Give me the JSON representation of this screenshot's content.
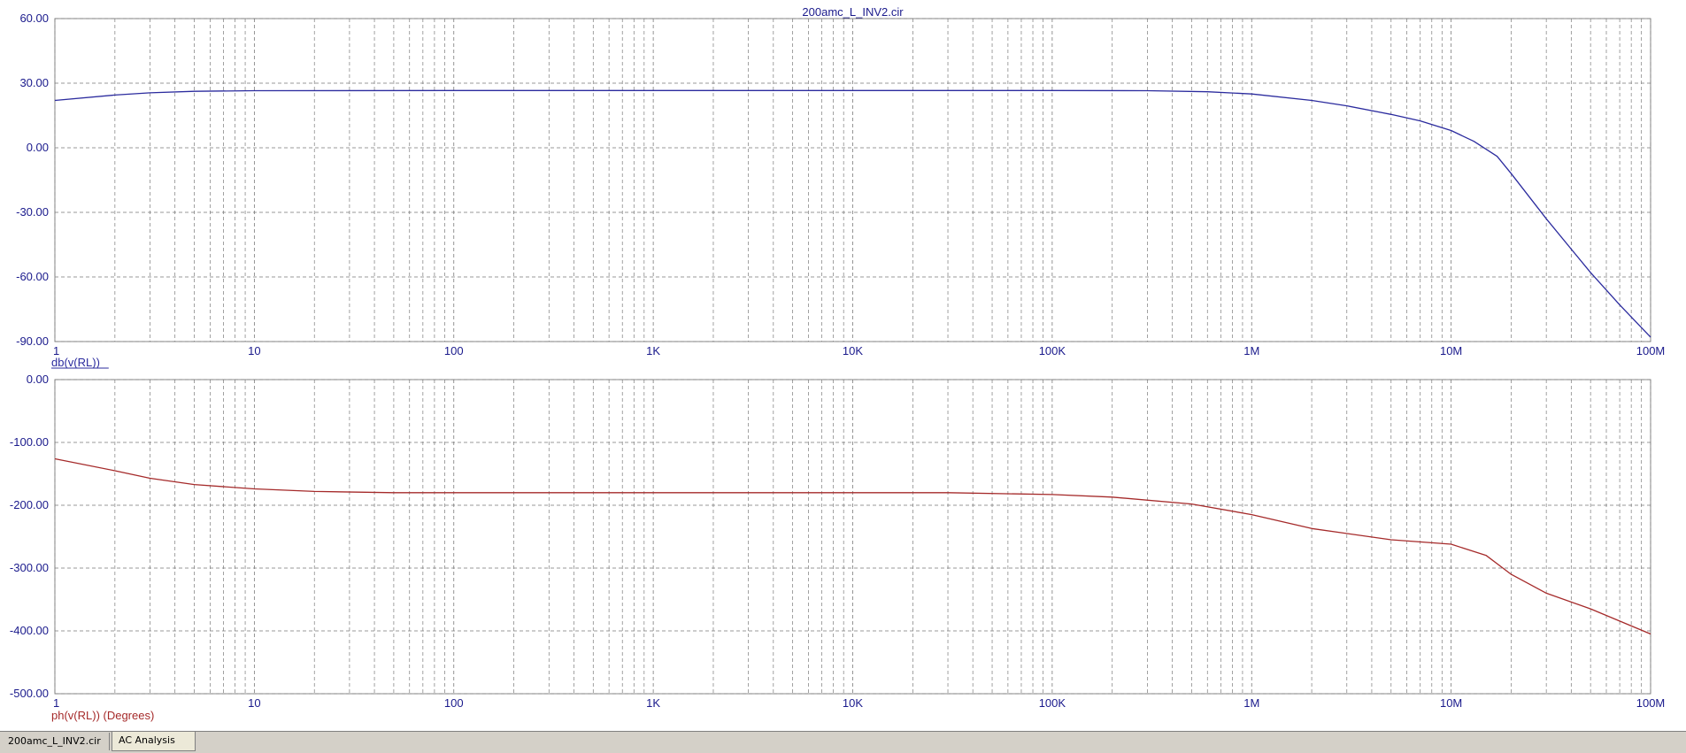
{
  "window_title": "200amc_L_INV2.cir",
  "tabs": [
    {
      "label": "200amc_L_INV2.cir",
      "active": false
    },
    {
      "label": "AC Analysis",
      "active": true
    }
  ],
  "colors": {
    "magnitude": "#2b2b9e",
    "phase": "#a52a2a",
    "axis_text": "#1a1a8c",
    "grid": "#7a7a7a",
    "frame": "#888888"
  },
  "chart_data": [
    {
      "type": "line",
      "title": "200amc_L_INV2.cir",
      "xscale": "log",
      "xlim": [
        1,
        100000000
      ],
      "xticks": [
        1,
        10,
        100,
        1000,
        10000,
        100000,
        1000000,
        10000000,
        100000000
      ],
      "xtick_labels": [
        "1",
        "10",
        "100",
        "1K",
        "10K",
        "100K",
        "1M",
        "10M",
        "100M"
      ],
      "ylim": [
        -90,
        60
      ],
      "yticks": [
        60,
        30,
        0,
        -30,
        -60,
        -90
      ],
      "ytick_labels": [
        "60.00",
        "30.00",
        "0.00",
        "-30.00",
        "-60.00",
        "-90.00"
      ],
      "grid": true,
      "series": [
        {
          "name": "db(v(RL))",
          "color": "#2b2b9e",
          "x": [
            1,
            2,
            3,
            5,
            10,
            100,
            1000,
            10000,
            100000,
            300000,
            600000,
            1000000,
            2000000,
            3000000,
            5000000,
            7000000,
            10000000,
            13000000,
            17000000,
            20000000,
            30000000,
            50000000,
            70000000,
            100000000
          ],
          "y": [
            22,
            24.5,
            25.5,
            26.2,
            26.5,
            26.6,
            26.6,
            26.6,
            26.6,
            26.5,
            26,
            25,
            22,
            19.5,
            15.5,
            12.5,
            8,
            3,
            -4,
            -12,
            -33,
            -58,
            -73,
            -88
          ]
        }
      ]
    },
    {
      "type": "line",
      "xscale": "log",
      "xlim": [
        1,
        100000000
      ],
      "xticks": [
        1,
        10,
        100,
        1000,
        10000,
        100000,
        1000000,
        10000000,
        100000000
      ],
      "xtick_labels": [
        "1",
        "10",
        "100",
        "1K",
        "10K",
        "100K",
        "1M",
        "10M",
        "100M"
      ],
      "ylim": [
        -500,
        0
      ],
      "yticks": [
        0,
        -100,
        -200,
        -300,
        -400,
        -500
      ],
      "ytick_labels": [
        "0.00",
        "-100.00",
        "-200.00",
        "-300.00",
        "-400.00",
        "-500.00"
      ],
      "grid": true,
      "series": [
        {
          "name": "ph(v(RL)) (Degrees)",
          "color": "#a52a2a",
          "x": [
            1,
            2,
            3,
            5,
            10,
            20,
            50,
            100,
            1000,
            10000,
            30000,
            100000,
            200000,
            500000,
            1000000,
            2000000,
            5000000,
            10000000,
            15000000,
            20000000,
            30000000,
            50000000,
            100000000
          ],
          "y": [
            -126,
            -145,
            -157,
            -167,
            -174,
            -178,
            -180,
            -180,
            -180,
            -180,
            -180,
            -183,
            -187,
            -198,
            -215,
            -237,
            -255,
            -262,
            -280,
            -310,
            -340,
            -365,
            -405
          ]
        }
      ]
    }
  ]
}
